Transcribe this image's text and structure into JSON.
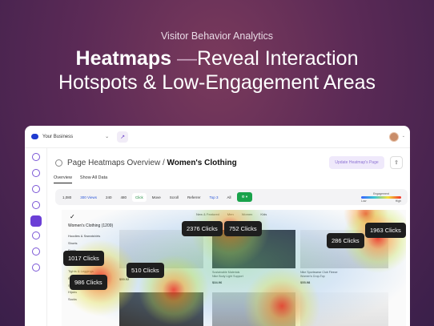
{
  "hero": {
    "eyebrow": "Visitor Behavior Analytics",
    "title_bold": "Heatmaps",
    "title_dash": "—",
    "title_rest": "Reveal Interaction",
    "title_line2": "Hotspots & Low-Engagement Areas"
  },
  "topbar": {
    "business": "Your Business",
    "business_caret": "⌄",
    "external_icon": "↗",
    "avatar_caret": "⌄"
  },
  "header": {
    "crumb_parent": "Page Heatmaps Overview /",
    "crumb_current": "Women's Clothing",
    "update_button": "Update Heatmap's Page",
    "share_icon": "⇪"
  },
  "tabs": [
    {
      "label": "Overview"
    },
    {
      "label": "Show All Data"
    }
  ],
  "controls": {
    "views_count": "1,080",
    "views_active": "300 Views",
    "count_a": "240",
    "count_b": "480",
    "click": "Click",
    "move": "Move",
    "scroll": "Scroll",
    "referrer": "Referrer",
    "top": "Top 3",
    "all": "All",
    "engagement_title": "Engagement",
    "engagement_low": "Low",
    "engagement_high": "High"
  },
  "preview": {
    "nav": [
      "New & Featured",
      "Men",
      "Women",
      "Kids"
    ],
    "category_heading": "Women's Clothing (1209)",
    "categories": [
      "Hoodies & Sweatshirts",
      "Shorts",
      "Pants",
      "Jackets",
      "Tops & T-Shirts",
      "Tights & Leggings",
      "Bodysuits",
      "Surf & Swimwear",
      "Hijabs",
      "Socks"
    ],
    "products": [
      {
        "name": "Sustainable Materials",
        "desc": "Nike Body Light Support",
        "price": "$34.96"
      },
      {
        "name": "Nike Sportswear Club Fleece",
        "desc": "Women's Crop-Top",
        "price": "$55.98"
      },
      {
        "name": "",
        "desc": "",
        "price": "$59.92"
      }
    ]
  },
  "hotspots": [
    {
      "label": "2376 Clicks"
    },
    {
      "label": "752 Clicks"
    },
    {
      "label": "286 Clicks"
    },
    {
      "label": "1963 Clicks"
    },
    {
      "label": "1017 Clicks"
    },
    {
      "label": "510 Clicks"
    },
    {
      "label": "986 Clicks"
    }
  ]
}
